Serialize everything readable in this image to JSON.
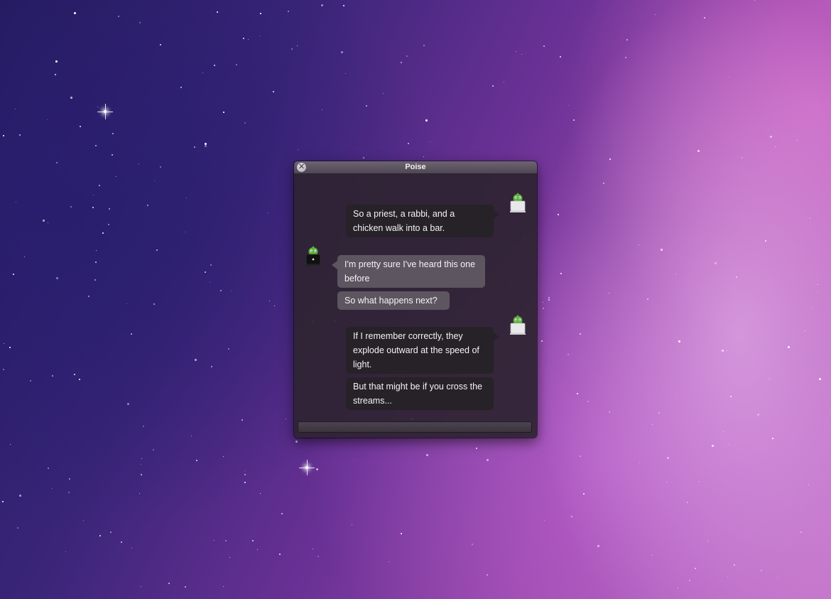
{
  "window": {
    "title": "Poise",
    "close_glyph": "✕"
  },
  "messages": [
    {
      "side": "right",
      "text": "So a priest, a rabbi, and a chicken walk into a bar."
    },
    {
      "side": "left",
      "text": "I'm pretty sure I've heard this one before"
    },
    {
      "side": "left",
      "text": "So what happens next?"
    },
    {
      "side": "right",
      "text": "If I remember correctly, they explode outward at the speed of light."
    },
    {
      "side": "right",
      "text": "But that might be if you cross the streams..."
    }
  ],
  "input": {
    "value": "",
    "placeholder": ""
  },
  "avatars": {
    "local_icon": "adium-duck-white-laptop-icon",
    "remote_icon": "adium-duck-black-laptop-icon",
    "duck_color": "#5cb23a"
  },
  "colors": {
    "outgoing_bubble": "#262228",
    "incoming_bubble": "#5d5560",
    "window_bg": "#2e2432"
  }
}
